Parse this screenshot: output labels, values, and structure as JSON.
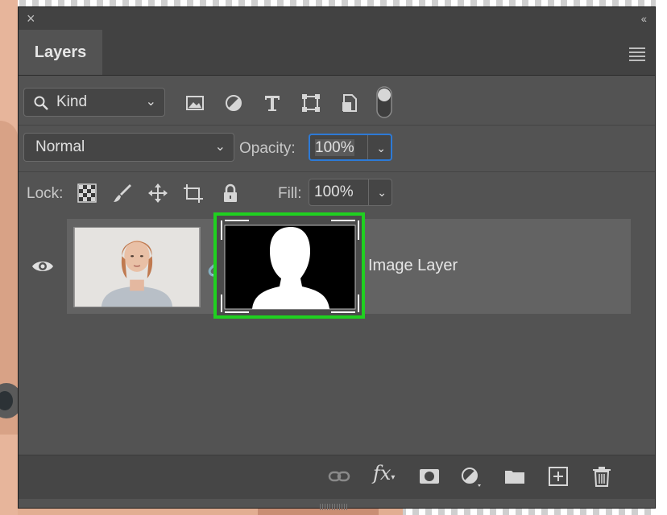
{
  "window": {
    "close_glyph": "×",
    "collapse_glyph": "‹‹"
  },
  "panel": {
    "tab_title": "Layers"
  },
  "filter": {
    "kind_label": "Kind",
    "icons": [
      "image-filter-icon",
      "adjustment-filter-icon",
      "type-filter-icon",
      "shape-filter-icon",
      "smart-object-filter-icon",
      "filter-toggle-icon"
    ]
  },
  "blend": {
    "mode": "Normal",
    "opacity_label": "Opacity:",
    "opacity_value": "100%"
  },
  "lock": {
    "label": "Lock:",
    "fill_label": "Fill:",
    "fill_value": "100%",
    "icons": [
      "lock-transparent-icon",
      "lock-paint-icon",
      "lock-position-icon",
      "lock-artboard-icon",
      "lock-all-icon"
    ]
  },
  "layers": [
    {
      "name": "Image Layer",
      "visible": true,
      "has_mask": true
    }
  ],
  "footer": {
    "icons": [
      "link-layers-icon",
      "fx-icon",
      "add-mask-icon",
      "adjustment-layer-icon",
      "group-folder-icon",
      "new-layer-icon",
      "trash-icon"
    ],
    "fx_label": "fx"
  },
  "colors": {
    "highlight": "#20d020",
    "focus_ring": "#2d7ad6",
    "panel_bg": "#535353"
  }
}
